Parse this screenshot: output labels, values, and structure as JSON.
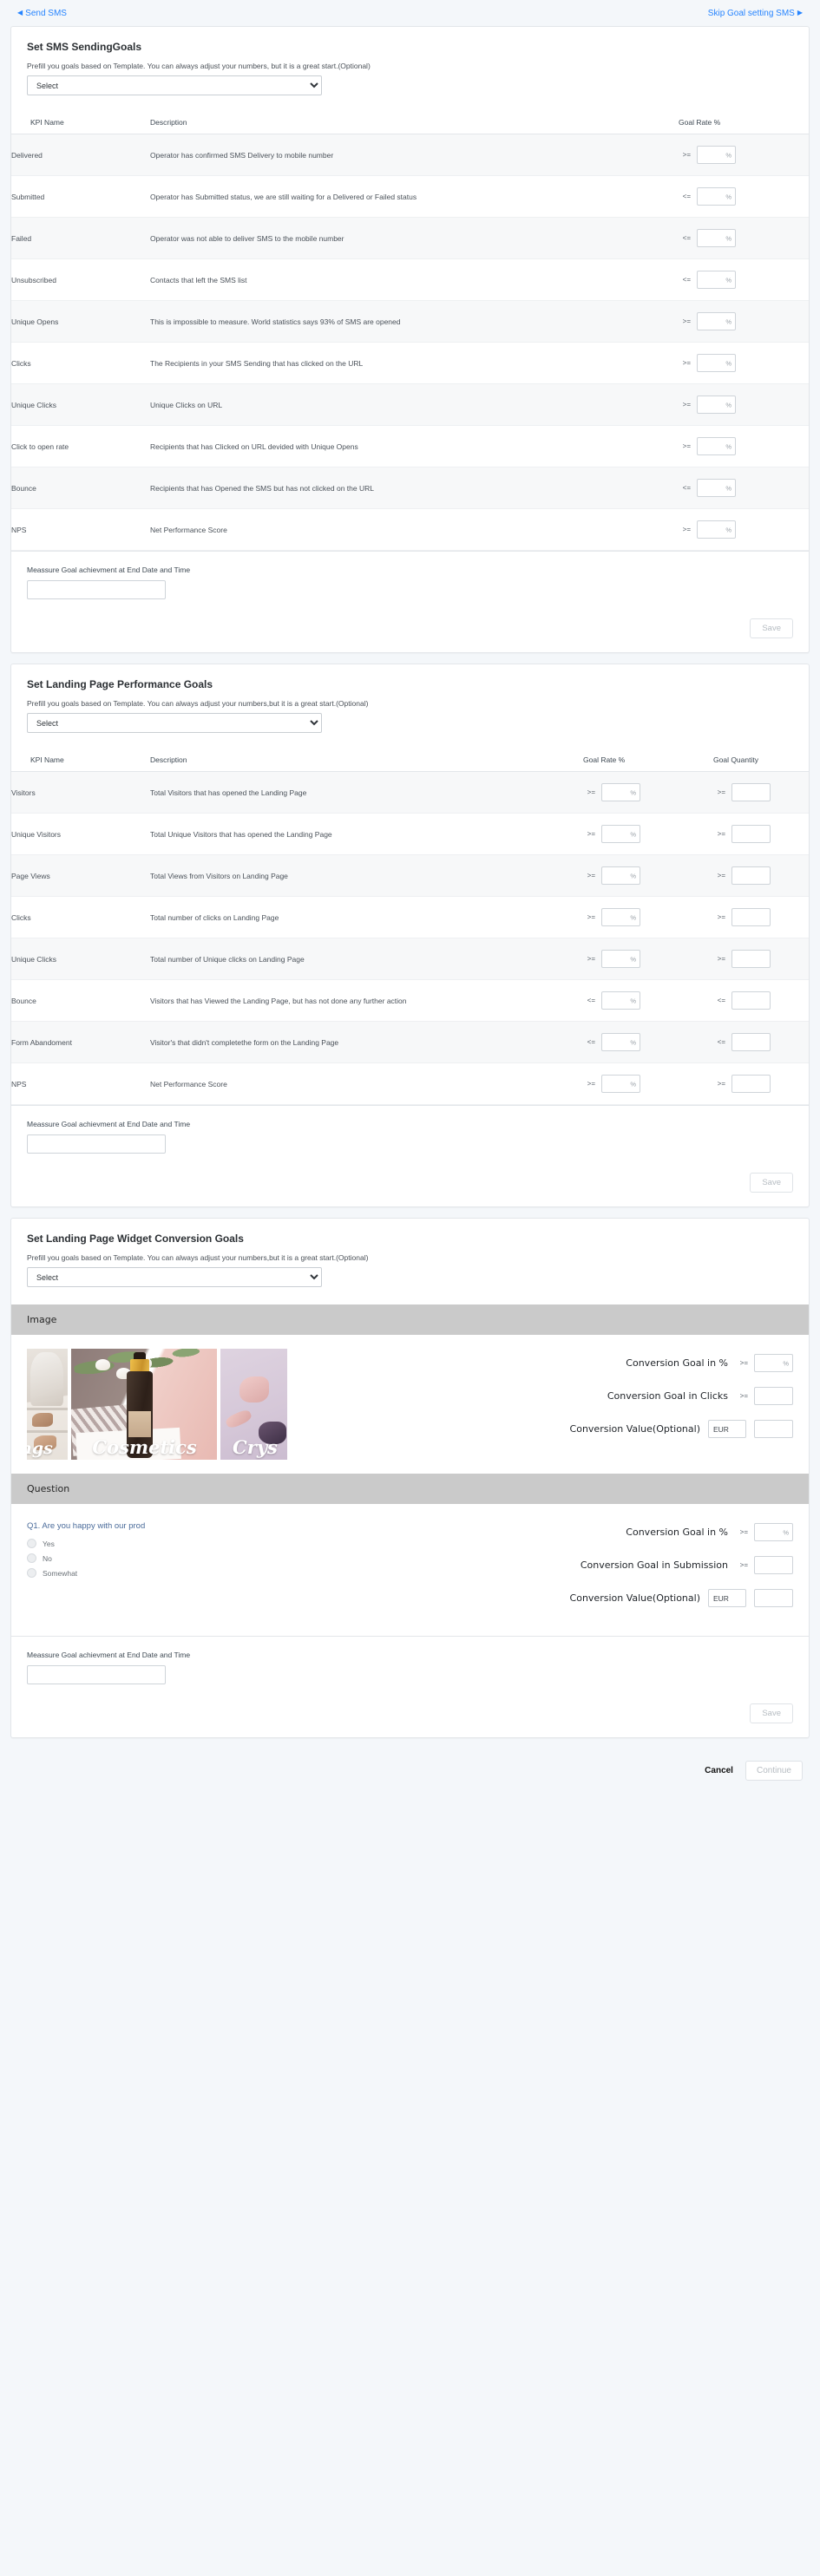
{
  "topbar": {
    "back_label": "Send SMS",
    "skip_label": "Skip Goal setting SMS"
  },
  "sms_card": {
    "title": "Set SMS SendingGoals",
    "subtitle": "Prefill you goals based on Template. You can always adjust your numbers, but it is a great start.(Optional)",
    "select_value": "Select",
    "columns": {
      "kpi": "KPI Name",
      "description": "Description",
      "rate": "Goal Rate %"
    },
    "rows": [
      {
        "kpi": "Delivered",
        "description": "Operator has confirmed SMS Delivery to mobile number",
        "op": ">=",
        "value": "",
        "suffix": "%"
      },
      {
        "kpi": "Submitted",
        "description": "Operator has Submitted status, we are still waiting for a Delivered or Failed status",
        "op": "<=",
        "value": "",
        "suffix": "%"
      },
      {
        "kpi": "Failed",
        "description": "Operator was not able to deliver SMS to the mobile number",
        "op": "<=",
        "value": "",
        "suffix": "%"
      },
      {
        "kpi": "Unsubscribed",
        "description": "Contacts that left the SMS list",
        "op": "<=",
        "value": "",
        "suffix": "%"
      },
      {
        "kpi": "Unique Opens",
        "description": "This is impossible to measure. World statistics says 93% of SMS are opened",
        "op": ">=",
        "value": "",
        "suffix": "%"
      },
      {
        "kpi": "Clicks",
        "description": "The Recipients in your SMS Sending that has clicked on the URL",
        "op": ">=",
        "value": "",
        "suffix": "%"
      },
      {
        "kpi": "Unique Clicks",
        "description": "Unique Clicks on URL",
        "op": ">=",
        "value": "",
        "suffix": "%"
      },
      {
        "kpi": "Click to open rate",
        "description": "Recipients that has Clicked on URL devided with Unique Opens",
        "op": ">=",
        "value": "",
        "suffix": "%"
      },
      {
        "kpi": "Bounce",
        "description": "Recipients that has Opened the SMS but has not clicked on the URL",
        "op": "<=",
        "value": "",
        "suffix": "%"
      },
      {
        "kpi": "NPS",
        "description": "Net Performance Score",
        "op": ">=",
        "value": "",
        "suffix": "%"
      }
    ],
    "measure_label": "Meassure Goal achievment at End Date and Time",
    "measure_value": "",
    "save_label": "Save"
  },
  "landing_card": {
    "title": "Set Landing Page Performance Goals",
    "subtitle": "Prefill you goals based on Template. You can always adjust your numbers,but it is a great start.(Optional)",
    "select_value": "Select",
    "columns": {
      "kpi": "KPI Name",
      "description": "Description",
      "rate": "Goal Rate %",
      "quantity": "Goal Quantity"
    },
    "rows": [
      {
        "kpi": "Visitors",
        "description": "Total Visitors that has opened the Landing Page",
        "rate_op": ">=",
        "rate_value": "",
        "qty_op": ">=",
        "qty_value": ""
      },
      {
        "kpi": "Unique Visitors",
        "description": "Total Unique Visitors that has opened the Landing Page",
        "rate_op": ">=",
        "rate_value": "",
        "qty_op": ">=",
        "qty_value": ""
      },
      {
        "kpi": "Page Views",
        "description": "Total Views from Visitors on Landing Page",
        "rate_op": ">=",
        "rate_value": "",
        "qty_op": ">=",
        "qty_value": ""
      },
      {
        "kpi": "Clicks",
        "description": "Total number of clicks on Landing Page",
        "rate_op": ">=",
        "rate_value": "",
        "qty_op": ">=",
        "qty_value": ""
      },
      {
        "kpi": "Unique Clicks",
        "description": "Total number of Unique clicks on Landing Page",
        "rate_op": ">=",
        "rate_value": "",
        "qty_op": ">=",
        "qty_value": ""
      },
      {
        "kpi": "Bounce",
        "description": "Visitors that has Viewed the Landing Page, but has not done any further action",
        "rate_op": "<=",
        "rate_value": "",
        "qty_op": "<=",
        "qty_value": ""
      },
      {
        "kpi": "Form Abandoment",
        "description": "Visitor's that didn't completethe form on the Landing Page",
        "rate_op": "<=",
        "rate_value": "",
        "qty_op": "<=",
        "qty_value": ""
      },
      {
        "kpi": "NPS",
        "description": "Net Performance Score",
        "rate_op": ">=",
        "rate_value": "",
        "qty_op": ">=",
        "qty_value": ""
      }
    ],
    "measure_label": "Meassure Goal achievment at End Date and Time",
    "measure_value": "",
    "save_label": "Save"
  },
  "widget_card": {
    "title": "Set Landing Page Widget Conversion Goals",
    "subtitle": "Prefill you goals based on Template. You can always adjust your numbers,but it is a great start.(Optional)",
    "select_value": "Select",
    "image_section": {
      "band_label": "Image",
      "collage_captions": [
        "ngs",
        "Cosmetics",
        "Crys"
      ],
      "fields": [
        {
          "label": "Conversion Goal in %",
          "op": ">=",
          "value": "",
          "suffix": "%"
        },
        {
          "label": "Conversion Goal in Clicks",
          "op": ">=",
          "value": "",
          "suffix": ""
        }
      ],
      "value_field": {
        "label": "Conversion Value(Optional)",
        "currency": "EUR",
        "value": ""
      }
    },
    "question_section": {
      "band_label": "Question",
      "question_title": "Q1. Are you happy with our prod",
      "options": [
        "Yes",
        "No",
        "Somewhat"
      ],
      "fields": [
        {
          "label": "Conversion Goal in %",
          "op": ">=",
          "value": "",
          "suffix": "%"
        },
        {
          "label": "Conversion Goal in Submission",
          "op": ">=",
          "value": "",
          "suffix": ""
        }
      ],
      "value_field": {
        "label": "Conversion Value(Optional)",
        "currency": "EUR",
        "value": ""
      }
    },
    "measure_label": "Meassure Goal achievment at End Date and Time",
    "measure_value": "",
    "save_label": "Save"
  },
  "footer": {
    "cancel_label": "Cancel",
    "continue_label": "Continue"
  }
}
